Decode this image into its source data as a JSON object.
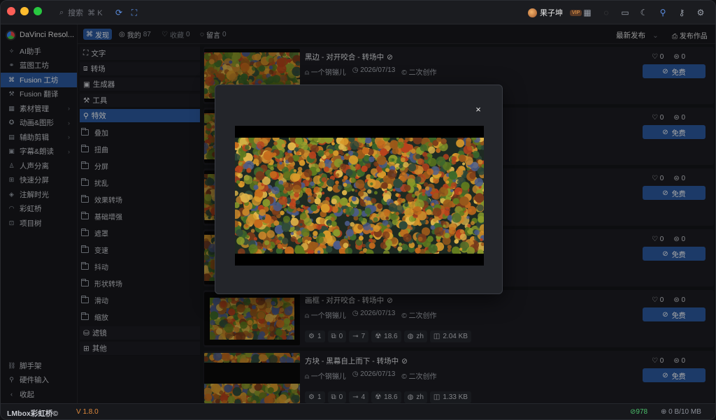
{
  "titlebar": {
    "search_placeholder": "搜索",
    "search_shortcut": "⌘ K",
    "user_name": "果子坤",
    "user_badge": "VIP"
  },
  "sidebar": {
    "app_name": "DaVinci Resol...",
    "items": [
      {
        "label": "AI助手",
        "icon": "ai-icon"
      },
      {
        "label": "蓝图工坊",
        "icon": "blueprint-icon"
      },
      {
        "label": "Fusion 工坊",
        "icon": "fusion-icon",
        "active": true
      },
      {
        "label": "Fusion 翻译",
        "icon": "translate-icon"
      },
      {
        "label": "素材管理",
        "icon": "assets-icon",
        "has_children": true
      },
      {
        "label": "动画&图形",
        "icon": "animation-icon",
        "has_children": true
      },
      {
        "label": "辅助剪辑",
        "icon": "edit-assist-icon",
        "has_children": true
      },
      {
        "label": "字幕&朗读",
        "icon": "subtitle-icon",
        "has_children": true
      },
      {
        "label": "人声分离",
        "icon": "voice-icon"
      },
      {
        "label": "快速分屏",
        "icon": "split-icon"
      },
      {
        "label": "注解时光",
        "icon": "note-icon"
      },
      {
        "label": "彩虹桥",
        "icon": "rainbow-icon"
      },
      {
        "label": "项目树",
        "icon": "tree-icon"
      }
    ],
    "bottom_items": [
      {
        "label": "脚手架",
        "icon": "scaffold-icon"
      },
      {
        "label": "硬件输入",
        "icon": "hardware-icon"
      },
      {
        "label": "收起",
        "icon": "collapse-icon"
      }
    ]
  },
  "tabs": {
    "discover": "发现",
    "mine": "我的",
    "mine_count": "87",
    "favorites": "收藏",
    "favorites_count": "0",
    "comments": "留言",
    "comments_count": "0",
    "sort_label": "最新发布",
    "publish_label": "发布作品"
  },
  "categories": {
    "top": [
      {
        "label": "文字",
        "icon": "text-icon"
      },
      {
        "label": "转场",
        "icon": "transition-icon"
      },
      {
        "label": "生成器",
        "icon": "generator-icon"
      },
      {
        "label": "工具",
        "icon": "tool-icon"
      },
      {
        "label": "特效",
        "icon": "effect-icon",
        "active": true
      }
    ],
    "effects": [
      "叠加",
      "扭曲",
      "分屏",
      "扰乱",
      "效果转场",
      "基础增强",
      "遮罩",
      "变速",
      "抖动",
      "形状转场",
      "滑动",
      "缩放"
    ],
    "bottom": [
      {
        "label": "滤镜",
        "icon": "filter-icon"
      },
      {
        "label": "其他",
        "icon": "other-icon"
      }
    ]
  },
  "items": [
    {
      "title": "黑边 - 对开咬合 - 转场中",
      "author": "一个钢镚儿",
      "date": "2026/07/13",
      "license": "二次创作",
      "likes": "0",
      "comments": "0",
      "price": "免费",
      "stats": null
    },
    {
      "title": "",
      "author": "",
      "date": "",
      "license": "",
      "likes": "0",
      "comments": "0",
      "price": "免费",
      "stats": null
    },
    {
      "title": "",
      "author": "",
      "date": "",
      "license": "",
      "likes": "0",
      "comments": "0",
      "price": "免费",
      "stats": null
    },
    {
      "title": "",
      "author": "",
      "date": "",
      "license": "",
      "likes": "0",
      "comments": "0",
      "price": "免费",
      "stats": null
    },
    {
      "title": "画框 - 对开咬合 - 转场中",
      "author": "一个钢镚儿",
      "date": "2026/07/13",
      "license": "二次创作",
      "likes": "0",
      "comments": "0",
      "price": "免费",
      "stats": {
        "nodes": "1",
        "copies": "0",
        "links": "7",
        "version": "18.6",
        "lang": "zh",
        "size": "2.04 KB"
      }
    },
    {
      "title": "方块 - 黑幕自上而下 - 转场中",
      "author": "一个钢镚儿",
      "date": "2026/07/13",
      "license": "二次创作",
      "likes": "0",
      "comments": "0",
      "price": "免费",
      "stats": {
        "nodes": "1",
        "copies": "0",
        "links": "4",
        "version": "18.6",
        "lang": "zh",
        "size": "1.33 KB"
      }
    }
  ],
  "modal": {
    "close_label": "×"
  },
  "statusbar": {
    "brand": "LMbox彩虹桥©",
    "version": "V 1.8.0",
    "online": "978",
    "storage": "0 B/10 MB"
  },
  "colors": {
    "accent": "#2c5aa0",
    "version": "#e08a3c",
    "online": "#4bbf6a"
  }
}
